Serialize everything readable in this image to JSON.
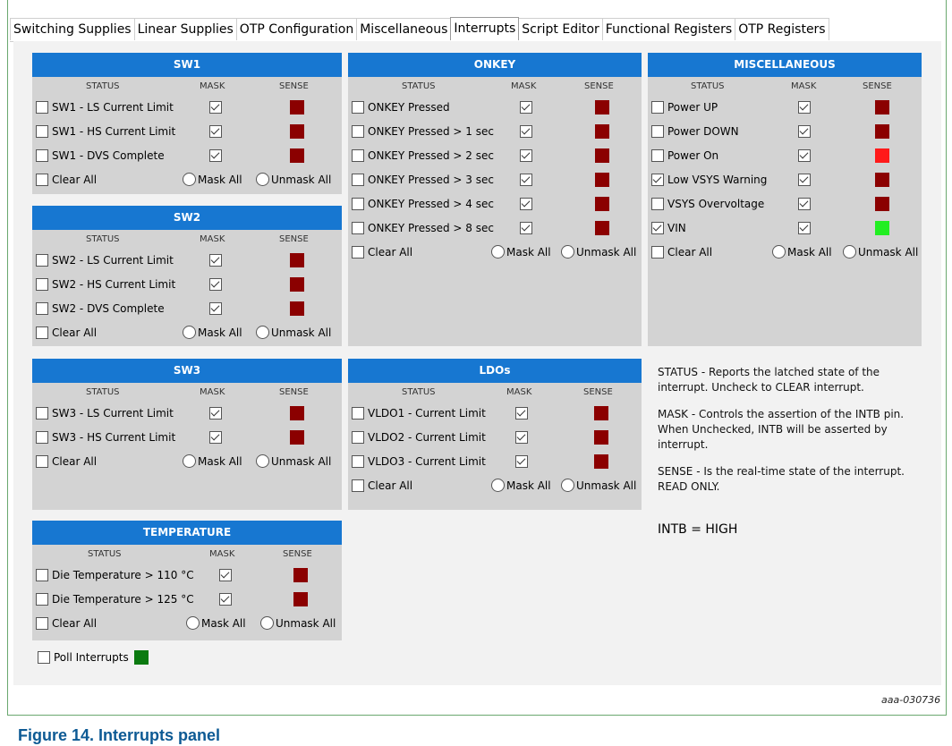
{
  "tabs": [
    {
      "label": "Switching Supplies",
      "active": false
    },
    {
      "label": "Linear Supplies",
      "active": false
    },
    {
      "label": "OTP Configuration",
      "active": false
    },
    {
      "label": "Miscellaneous",
      "active": false
    },
    {
      "label": "Interrupts",
      "active": true
    },
    {
      "label": "Script Editor",
      "active": false
    },
    {
      "label": "Functional Registers",
      "active": false
    },
    {
      "label": "OTP Registers",
      "active": false
    }
  ],
  "headers": {
    "status": "STATUS",
    "mask": "MASK",
    "sense": "SENSE"
  },
  "common": {
    "clear_all": "Clear All",
    "mask_all": "Mask All",
    "unmask_all": "Unmask All"
  },
  "colors": {
    "title_bar": "#1777d1",
    "sense_off": "#8b0000",
    "sense_red": "#ff1a1a",
    "sense_green": "#22ee22",
    "poll_green": "#0b7a10"
  },
  "panels": {
    "sw1": {
      "title": "SW1",
      "rows": [
        {
          "label": "SW1 - LS Current Limit",
          "status": false,
          "mask": true,
          "sense": "sense_off"
        },
        {
          "label": "SW1 - HS Current Limit",
          "status": false,
          "mask": true,
          "sense": "sense_off"
        },
        {
          "label": "SW1 - DVS Complete",
          "status": false,
          "mask": true,
          "sense": "sense_off"
        }
      ]
    },
    "sw2": {
      "title": "SW2",
      "rows": [
        {
          "label": "SW2 - LS Current Limit",
          "status": false,
          "mask": true,
          "sense": "sense_off"
        },
        {
          "label": "SW2 - HS Current Limit",
          "status": false,
          "mask": true,
          "sense": "sense_off"
        },
        {
          "label": "SW2 - DVS Complete",
          "status": false,
          "mask": true,
          "sense": "sense_off"
        }
      ]
    },
    "sw3": {
      "title": "SW3",
      "rows": [
        {
          "label": "SW3 - LS Current Limit",
          "status": false,
          "mask": true,
          "sense": "sense_off"
        },
        {
          "label": "SW3 - HS Current Limit",
          "status": false,
          "mask": true,
          "sense": "sense_off"
        }
      ]
    },
    "temperature": {
      "title": "TEMPERATURE",
      "rows": [
        {
          "label": "Die Temperature > 110 °C",
          "status": false,
          "mask": true,
          "sense": "sense_off"
        },
        {
          "label": "Die Temperature > 125 °C",
          "status": false,
          "mask": true,
          "sense": "sense_off"
        }
      ]
    },
    "onkey": {
      "title": "ONKEY",
      "rows": [
        {
          "label": "ONKEY Pressed",
          "status": false,
          "mask": true,
          "sense": "sense_off"
        },
        {
          "label": "ONKEY Pressed > 1 sec",
          "status": false,
          "mask": true,
          "sense": "sense_off"
        },
        {
          "label": "ONKEY Pressed > 2 sec",
          "status": false,
          "mask": true,
          "sense": "sense_off"
        },
        {
          "label": "ONKEY Pressed > 3 sec",
          "status": false,
          "mask": true,
          "sense": "sense_off"
        },
        {
          "label": "ONKEY Pressed > 4 sec",
          "status": false,
          "mask": true,
          "sense": "sense_off"
        },
        {
          "label": "ONKEY Pressed > 8 sec",
          "status": false,
          "mask": true,
          "sense": "sense_off"
        }
      ]
    },
    "ldos": {
      "title": "LDOs",
      "rows": [
        {
          "label": "VLDO1 - Current Limit",
          "status": false,
          "mask": true,
          "sense": "sense_off"
        },
        {
          "label": "VLDO2 - Current Limit",
          "status": false,
          "mask": true,
          "sense": "sense_off"
        },
        {
          "label": "VLDO3 - Current Limit",
          "status": false,
          "mask": true,
          "sense": "sense_off"
        }
      ]
    },
    "misc": {
      "title": "MISCELLANEOUS",
      "rows": [
        {
          "label": "Power UP",
          "status": false,
          "mask": true,
          "sense": "sense_off"
        },
        {
          "label": "Power DOWN",
          "status": false,
          "mask": true,
          "sense": "sense_off"
        },
        {
          "label": "Power On",
          "status": false,
          "mask": true,
          "sense": "sense_red"
        },
        {
          "label": "Low VSYS Warning",
          "status": true,
          "mask": true,
          "sense": "sense_off"
        },
        {
          "label": "VSYS Overvoltage",
          "status": false,
          "mask": true,
          "sense": "sense_off"
        },
        {
          "label": "VIN",
          "status": true,
          "mask": true,
          "sense": "sense_green"
        }
      ]
    }
  },
  "info": {
    "status_text": "STATUS - Reports the latched state of the interrupt. Uncheck to CLEAR interrupt.",
    "mask_text": "MASK - Controls the assertion of the INTB pin. When Unchecked, INTB will be asserted by interrupt.",
    "sense_text": "SENSE - Is the real-time state of the interrupt. READ ONLY.",
    "intb": "INTB = HIGH"
  },
  "poll": {
    "label": "Poll Interrupts",
    "checked": false
  },
  "figure_id": "aaa-030736",
  "caption": "Figure 14.  Interrupts panel"
}
